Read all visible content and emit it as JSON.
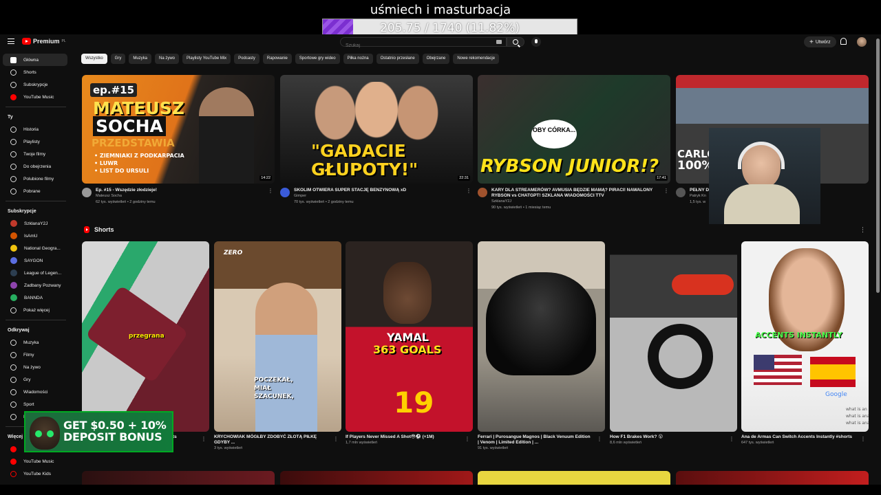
{
  "overlay": {
    "title": "uśmiech i masturbacja",
    "progress_text": "205.75 / 1740 (11.82%)",
    "progress_fraction": 0.1182
  },
  "header": {
    "logo": "Premium",
    "logo_sup": "PL",
    "search_placeholder": "Szukaj",
    "create_label": "Utwórz"
  },
  "sidebar": {
    "main": [
      {
        "label": "Główna",
        "icon": "home-icon",
        "active": true
      },
      {
        "label": "Shorts",
        "icon": "shorts-icon"
      },
      {
        "label": "Subskrypcje",
        "icon": "subscriptions-icon"
      },
      {
        "label": "YouTube Music",
        "icon": "youtube-music-icon"
      }
    ],
    "you_header": "Ty",
    "you": [
      {
        "label": "Historia",
        "icon": "history-icon"
      },
      {
        "label": "Playlisty",
        "icon": "playlists-icon"
      },
      {
        "label": "Twoje filmy",
        "icon": "your-videos-icon"
      },
      {
        "label": "Do obejrzenia",
        "icon": "watch-later-icon"
      },
      {
        "label": "Polubione filmy",
        "icon": "liked-icon"
      },
      {
        "label": "Pobrane",
        "icon": "download-icon"
      }
    ],
    "subs_header": "Subskrypcje",
    "subs": [
      {
        "label": "SzklanaY2J",
        "color": "#c0392b"
      },
      {
        "label": "IsAmU",
        "color": "#d35400"
      },
      {
        "label": "National Geogra...",
        "color": "#f1c40f"
      },
      {
        "label": "SAYGON",
        "color": "#5b6ee1"
      },
      {
        "label": "League of Legen...",
        "color": "#2c3e50"
      },
      {
        "label": "Zadbany Pozwany",
        "color": "#8e44ad"
      },
      {
        "label": "BANNDA",
        "color": "#27ae60"
      },
      {
        "label": "Pokaż więcej",
        "color": ""
      }
    ],
    "explore_header": "Odkrywaj",
    "explore": [
      {
        "label": "Muzyka",
        "icon": "music-icon"
      },
      {
        "label": "Filmy",
        "icon": "movies-icon"
      },
      {
        "label": "Na żywo",
        "icon": "live-icon"
      },
      {
        "label": "Gry",
        "icon": "gaming-icon"
      },
      {
        "label": "Wiadomości",
        "icon": "news-icon"
      },
      {
        "label": "Sport",
        "icon": "sport-icon"
      },
      {
        "label": "P",
        "icon": "podcast-icon"
      }
    ],
    "more_header": "Więcej z",
    "more": [
      {
        "label": "",
        "icon": "youtube-icon"
      },
      {
        "label": "YouTube Music",
        "icon": "youtube-music-icon"
      },
      {
        "label": "YouTube Kids",
        "icon": "youtube-kids-icon"
      }
    ]
  },
  "chips": [
    "Wszystko",
    "Gry",
    "Muzyka",
    "Na żywo",
    "Playlisty YouTube Mix",
    "Podcasty",
    "Rapowanie",
    "Sportowe gry wideo",
    "Piłka nożna",
    "Ostatnio przesłane",
    "Obejrzane",
    "Nowe rekomendacje"
  ],
  "videos": [
    {
      "title": "Ep. #15 - Wszędzie złodzieje!",
      "channel": "Mateusz Socha",
      "meta": "62 tys. wyświetleń • 2 godziny temu",
      "duration": "14:22",
      "thumb_text_1": "ep.#15",
      "thumb_text_2": "MATEUSZ",
      "thumb_text_3": "SOCHA",
      "thumb_text_4": "PRZEDSTAWIA",
      "thumb_list": "• ZIEMNIAKI Z PODKARPACIA\n• LUWR\n• LIST DO URSULI"
    },
    {
      "title": "SKOLIM OTWIERA SUPER STACJĘ BENZYNOWĄ xD",
      "channel": "Gimper",
      "meta": "70 tys. wyświetleń • 2 godziny temu",
      "duration": "22:31",
      "thumb_text_1": "\"GADACIE",
      "thumb_text_2": "GŁUPOTY!\""
    },
    {
      "title": "KARY DLA STREAMERÓW? AVMUSIA BĘDZIE MAMĄ? PIRACI! NAWALONY RYBSON vs CHATGPT! SZKLANA WIADOMOŚCI TTV",
      "channel": "SzklanaY2J",
      "meta": "90 tys. wyświetleń • 1 miesiąc temu",
      "duration": "17:41",
      "thumb_text_1": "RYBSON JUNIOR!?",
      "thumb_bubble": "OBY CÓRKA..."
    },
    {
      "title": "PEŁNY D",
      "channel": "Patryk Kn",
      "meta": "1,5 tys. w",
      "duration": "",
      "thumb_text_1": "CARLO",
      "thumb_text_2": "100%"
    }
  ],
  "shorts_header": "Shorts",
  "shorts": [
    {
      "title": "ts",
      "views": "",
      "overlay": "przegrana"
    },
    {
      "title": "KRYCHOWIAK MÓGŁBY ZDOBYĆ ZŁOTĄ PIŁKĘ GDYBY ...",
      "views": "3 tys. wyświetleń",
      "overlay": "POCZEKAŁ, MIAŁ SZACUNEK,",
      "tag": "ZERO"
    },
    {
      "title": "If Players Never Missed A Shot😳⚽️ (+1M)",
      "views": "1,7 mln wyświetleń",
      "overlay": "YAMAL",
      "overlay2": "363 GOALS",
      "number": "19"
    },
    {
      "title": "Ferrari | Purosangue Magnos | Black Venuum Edition | Venom | Limited Edition | ...",
      "views": "91 tys. wyświetleń",
      "overlay": ""
    },
    {
      "title": "How F1 Brakes Work? 😮",
      "views": "8,6 mln wyświetleń",
      "overlay": ""
    },
    {
      "title": "Ana de Armas Can Switch Accents Instantly #shorts",
      "views": "647 tys. wyświetleń",
      "overlay": "ACCENTS INSTANTLY",
      "google": "Google",
      "search_lines": "what is an\nwhat is ana\nwhat is ana"
    }
  ],
  "ad": {
    "text": "GET $0.50 + 10% DEPOSIT BONUS"
  }
}
